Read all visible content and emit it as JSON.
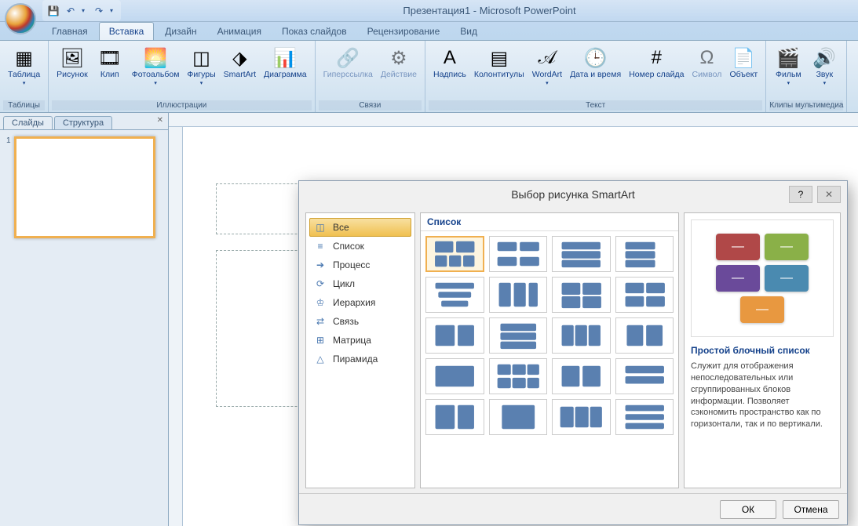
{
  "title": "Презентация1 - Microsoft PowerPoint",
  "qat": {
    "save": "💾",
    "undo": "↶",
    "redo": "↷"
  },
  "tabs": [
    "Главная",
    "Вставка",
    "Дизайн",
    "Анимация",
    "Показ слайдов",
    "Рецензирование",
    "Вид"
  ],
  "ribbon": {
    "groups": [
      {
        "label": "Таблицы",
        "items": [
          {
            "name": "table",
            "icon": "▦",
            "label": "Таблица",
            "dd": true
          }
        ]
      },
      {
        "label": "Иллюстрации",
        "items": [
          {
            "name": "picture",
            "icon": "🖼",
            "label": "Рисунок"
          },
          {
            "name": "clip",
            "icon": "🎞",
            "label": "Клип"
          },
          {
            "name": "album",
            "icon": "🌅",
            "label": "Фотоальбом",
            "dd": true
          },
          {
            "name": "shapes",
            "icon": "◫",
            "label": "Фигуры",
            "dd": true
          },
          {
            "name": "smartart",
            "icon": "⬗",
            "label": "SmartArt"
          },
          {
            "name": "chart",
            "icon": "📊",
            "label": "Диаграмма"
          }
        ]
      },
      {
        "label": "Связи",
        "items": [
          {
            "name": "hyperlink",
            "icon": "🔗",
            "label": "Гиперссылка",
            "disabled": true
          },
          {
            "name": "action",
            "icon": "⚙",
            "label": "Действие",
            "disabled": true
          }
        ]
      },
      {
        "label": "Текст",
        "items": [
          {
            "name": "textbox",
            "icon": "A",
            "label": "Надпись"
          },
          {
            "name": "headerfooter",
            "icon": "▤",
            "label": "Колонтитулы"
          },
          {
            "name": "wordart",
            "icon": "𝒜",
            "label": "WordArt",
            "dd": true
          },
          {
            "name": "datetime",
            "icon": "🕒",
            "label": "Дата и\nвремя"
          },
          {
            "name": "slidenum",
            "icon": "#",
            "label": "Номер\nслайда"
          },
          {
            "name": "symbol",
            "icon": "Ω",
            "label": "Символ",
            "disabled": true
          },
          {
            "name": "object",
            "icon": "📄",
            "label": "Объект"
          }
        ]
      },
      {
        "label": "Клипы мультимедиа",
        "items": [
          {
            "name": "movie",
            "icon": "🎬",
            "label": "Фильм",
            "dd": true
          },
          {
            "name": "sound",
            "icon": "🔊",
            "label": "Звук",
            "dd": true
          }
        ]
      }
    ]
  },
  "panel": {
    "tabs": [
      "Слайды",
      "Структура"
    ],
    "thumb_num": "1"
  },
  "dialog": {
    "title": "Выбор рисунка SmartArt",
    "cats": [
      {
        "icon": "◫",
        "label": "Все",
        "selected": true
      },
      {
        "icon": "≡",
        "label": "Список"
      },
      {
        "icon": "➔",
        "label": "Процесс"
      },
      {
        "icon": "⟳",
        "label": "Цикл"
      },
      {
        "icon": "♔",
        "label": "Иерархия"
      },
      {
        "icon": "⇄",
        "label": "Связь"
      },
      {
        "icon": "⊞",
        "label": "Матрица"
      },
      {
        "icon": "△",
        "label": "Пирамида"
      }
    ],
    "grid_header": "Список",
    "preview": {
      "colors": [
        "#b04848",
        "#8ab048",
        "#6a4a9a",
        "#4a8ab0",
        "#e89840"
      ],
      "title": "Простой блочный список",
      "desc": "Служит для отображения непоследовательных или сгруппированных блоков информации. Позволяет сэкономить пространство как по горизонтали, так и по вертикали."
    },
    "buttons": {
      "ok": "ОК",
      "cancel": "Отмена"
    }
  }
}
